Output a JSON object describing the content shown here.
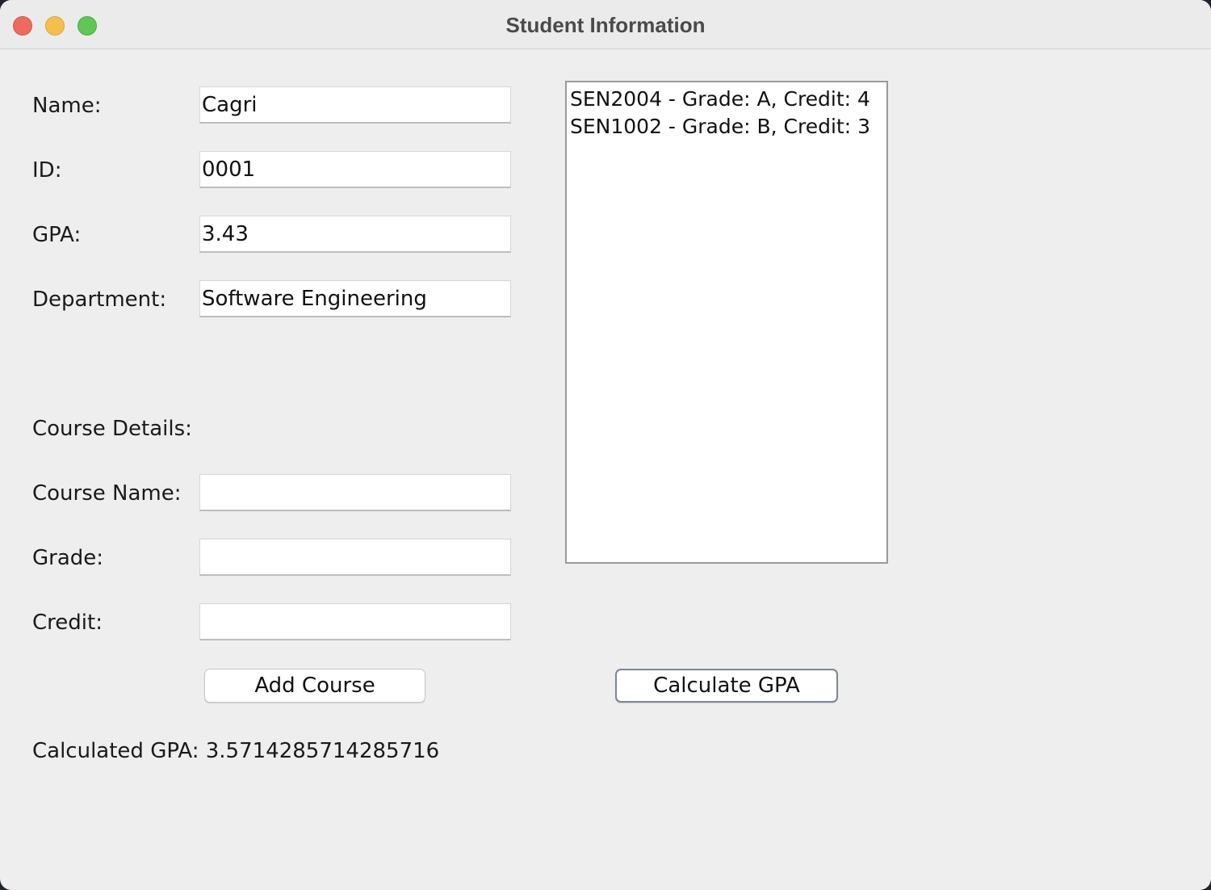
{
  "window": {
    "title": "Student Information"
  },
  "form": {
    "name_label": "Name:",
    "name_value": "Cagri",
    "id_label": "ID:",
    "id_value": "0001",
    "gpa_label": "GPA:",
    "gpa_value": "3.43",
    "department_label": "Department:",
    "department_value": "Software Engineering",
    "course_details_label": "Course Details:",
    "course_name_label": "Course Name:",
    "course_name_value": "",
    "grade_label": "Grade:",
    "grade_value": "",
    "credit_label": "Credit:",
    "credit_value": ""
  },
  "courses": [
    "SEN2004 - Grade: A, Credit: 4",
    "SEN1002 - Grade: B, Credit: 3"
  ],
  "buttons": {
    "add_course": "Add Course",
    "calculate_gpa": "Calculate GPA"
  },
  "result": {
    "calculated_gpa": "Calculated GPA: 3.5714285714285716"
  }
}
